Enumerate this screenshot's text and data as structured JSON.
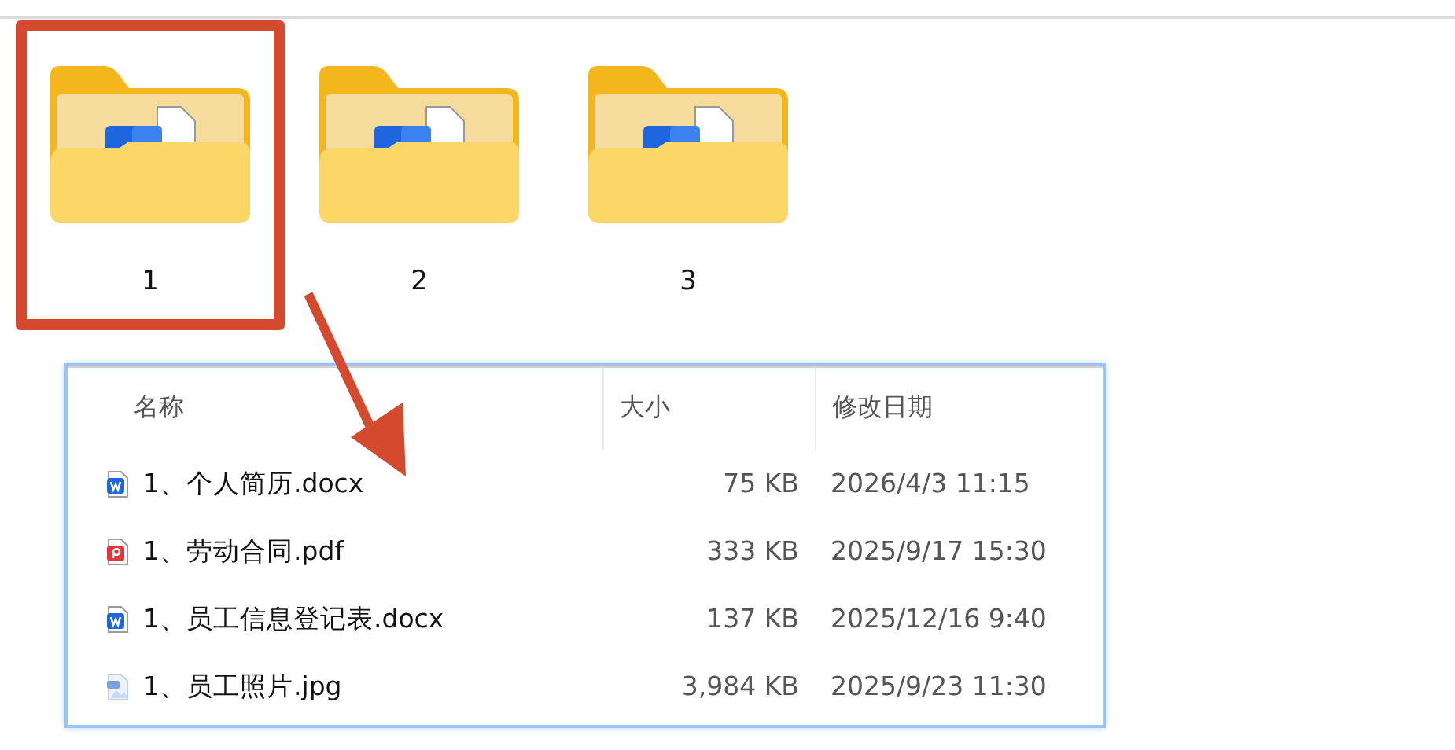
{
  "folders": [
    {
      "label": "1",
      "selected": true
    },
    {
      "label": "2",
      "selected": false
    },
    {
      "label": "3",
      "selected": false
    }
  ],
  "file_list": {
    "columns": [
      "名称",
      "大小",
      "修改日期"
    ],
    "rows": [
      {
        "kind": "word",
        "name": "1、个人简历.docx",
        "size": "75 KB",
        "modified": "2026/4/3 11:15"
      },
      {
        "kind": "pdf",
        "name": "1、劳动合同.pdf",
        "size": "333 KB",
        "modified": "2025/9/17 15:30"
      },
      {
        "kind": "word",
        "name": "1、员工信息登记表.docx",
        "size": "137 KB",
        "modified": "2025/12/16 9:40"
      },
      {
        "kind": "image",
        "name": "1、员工照片.jpg",
        "size": "3,984 KB",
        "modified": "2025/9/23 11:30"
      }
    ]
  }
}
